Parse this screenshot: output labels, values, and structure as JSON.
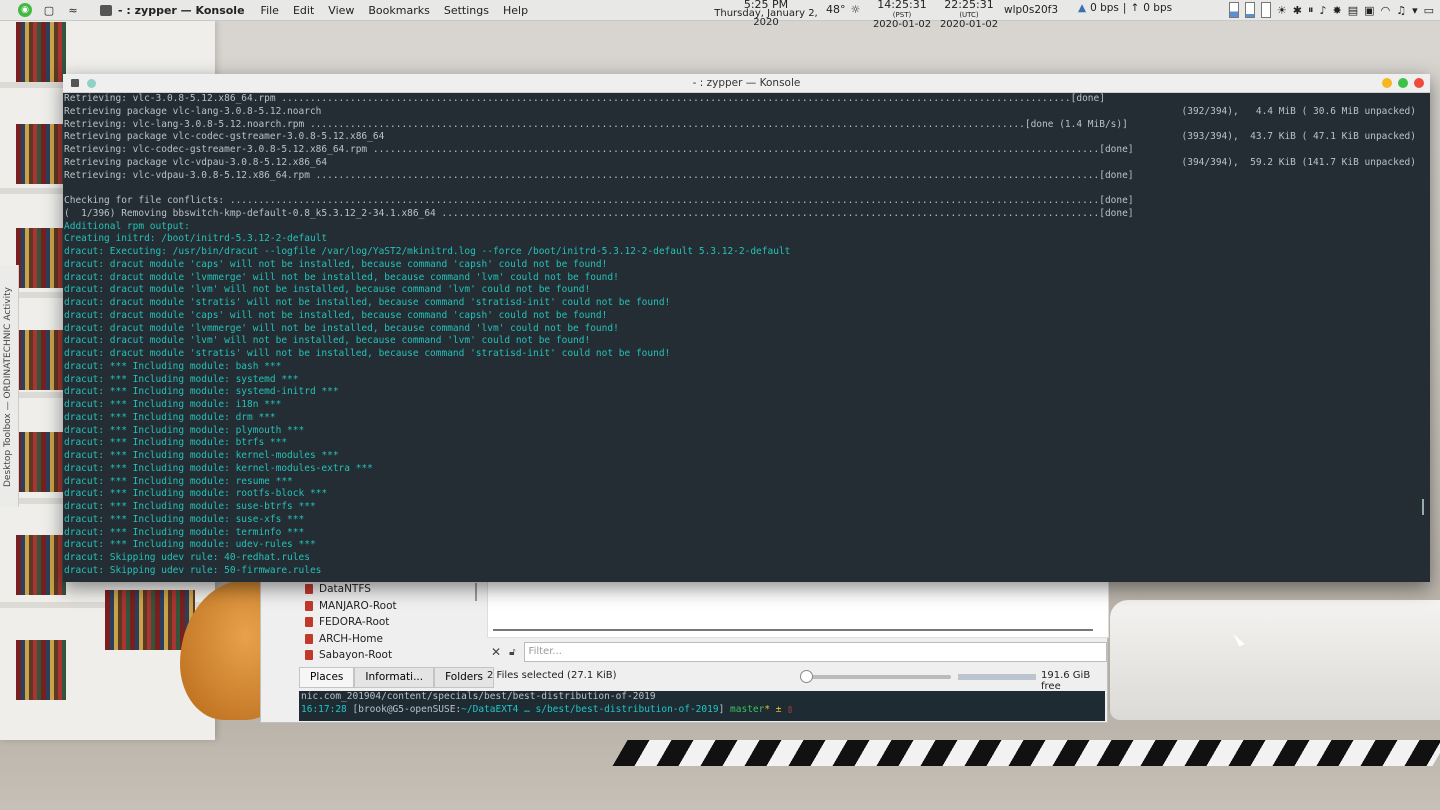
{
  "panel": {
    "task_title": "- : zypper — Konsole",
    "menu": [
      "File",
      "Edit",
      "View",
      "Bookmarks",
      "Settings",
      "Help"
    ],
    "time": "5:25 PM",
    "date": "Thursday, January 2, 2020",
    "temp": "48°",
    "pst_time": "14:25:31",
    "pst_label": "(PST)",
    "pst_date": "2020-01-02",
    "utc_time": "22:25:31",
    "utc_label": "(UTC)",
    "utc_date": "2020-01-02",
    "iface": "wlp0s20f3",
    "net_down": "0 bps",
    "net_up": "0 bps"
  },
  "side_strip": "Desktop Toolbox — ORDINATECHNIC Activity",
  "konsole": {
    "title": "- : zypper — Konsole",
    "lines": [
      {
        "t": "Retrieving: vlc-3.0.8-5.12.x86_64.rpm ..........................................................................................................................................[done]",
        "r": ""
      },
      {
        "t": "Retrieving package vlc-lang-3.0.8-5.12.noarch",
        "r": "(392/394),   4.4 MiB ( 30.6 MiB unpacked)"
      },
      {
        "t": "Retrieving: vlc-lang-3.0.8-5.12.noarch.rpm .............................................................................................................................[done (1.4 MiB/s)]",
        "r": ""
      },
      {
        "t": "Retrieving package vlc-codec-gstreamer-3.0.8-5.12.x86_64",
        "r": "(393/394),  43.7 KiB ( 47.1 KiB unpacked)"
      },
      {
        "t": "Retrieving: vlc-codec-gstreamer-3.0.8-5.12.x86_64.rpm ...............................................................................................................................[done]",
        "r": ""
      },
      {
        "t": "Retrieving package vlc-vdpau-3.0.8-5.12.x86_64",
        "r": "(394/394),  59.2 KiB (141.7 KiB unpacked)"
      },
      {
        "t": "Retrieving: vlc-vdpau-3.0.8-5.12.x86_64.rpm .........................................................................................................................................[done]",
        "r": ""
      },
      {
        "t": "",
        "r": ""
      },
      {
        "t": "Checking for file conflicts: ........................................................................................................................................................[done]",
        "r": ""
      },
      {
        "t": "(  1/396) Removing bbswitch-kmp-default-0.8_k5.3.12_2-34.1.x86_64 ...................................................................................................................[done]",
        "r": ""
      }
    ],
    "cyan_lines": [
      "Additional rpm output:",
      "Creating initrd: /boot/initrd-5.3.12-2-default",
      "dracut: Executing: /usr/bin/dracut --logfile /var/log/YaST2/mkinitrd.log --force /boot/initrd-5.3.12-2-default 5.3.12-2-default",
      "dracut: dracut module 'caps' will not be installed, because command 'capsh' could not be found!",
      "dracut: dracut module 'lvmmerge' will not be installed, because command 'lvm' could not be found!",
      "dracut: dracut module 'lvm' will not be installed, because command 'lvm' could not be found!",
      "dracut: dracut module 'stratis' will not be installed, because command 'stratisd-init' could not be found!",
      "dracut: dracut module 'caps' will not be installed, because command 'capsh' could not be found!",
      "dracut: dracut module 'lvmmerge' will not be installed, because command 'lvm' could not be found!",
      "dracut: dracut module 'lvm' will not be installed, because command 'lvm' could not be found!",
      "dracut: dracut module 'stratis' will not be installed, because command 'stratisd-init' could not be found!",
      "dracut: *** Including module: bash ***",
      "dracut: *** Including module: systemd ***",
      "dracut: *** Including module: systemd-initrd ***",
      "dracut: *** Including module: i18n ***",
      "dracut: *** Including module: drm ***",
      "dracut: *** Including module: plymouth ***",
      "dracut: *** Including module: btrfs ***",
      "dracut: *** Including module: kernel-modules ***",
      "dracut: *** Including module: kernel-modules-extra ***",
      "dracut: *** Including module: resume ***",
      "dracut: *** Including module: rootfs-block ***",
      "dracut: *** Including module: suse-btrfs ***",
      "dracut: *** Including module: suse-xfs ***",
      "dracut: *** Including module: terminfo ***",
      "dracut: *** Including module: udev-rules ***",
      "dracut: Skipping udev rule: 40-redhat.rules",
      "dracut: Skipping udev rule: 50-firmware.rules"
    ]
  },
  "dolphin": {
    "places": [
      "DataNTFS",
      "MANJARO-Root",
      "FEDORA-Root",
      "ARCH-Home",
      "Sabayon-Root"
    ],
    "filter_placeholder": "Filter...",
    "tabs": [
      "Places",
      "Informati...",
      "Folders"
    ],
    "status": "2 Files selected (27.1 KiB)",
    "free": "191.6 GiB free",
    "term_line1": "nic.com_201904/content/specials/best/best-distribution-of-2019",
    "term_time": "16:17:28",
    "term_prompt_a": "[brook@G5-openSUSE:",
    "term_path": "~/DataEXT4 … s/best/best-distribution-of-2019",
    "term_prompt_b": "]",
    "term_branch": "master",
    "term_star": "* ±"
  }
}
